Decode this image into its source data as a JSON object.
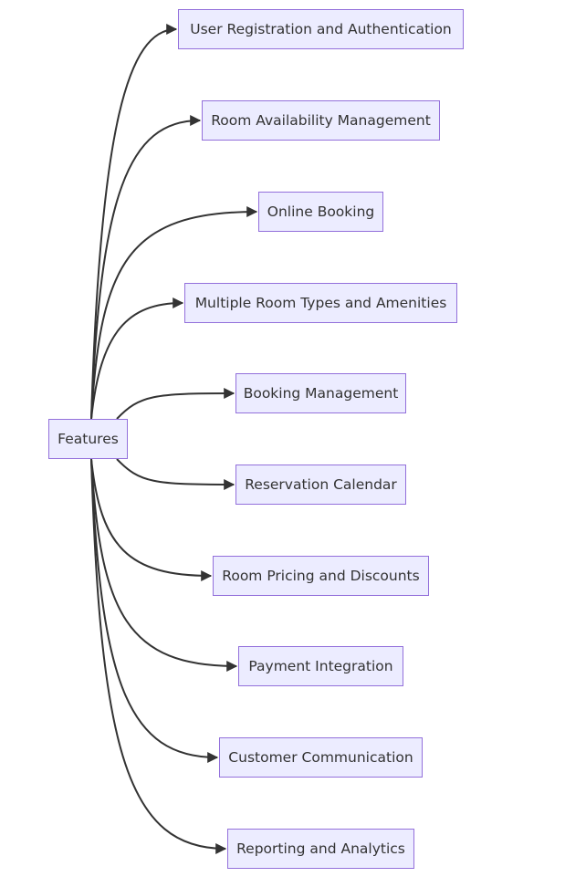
{
  "diagram": {
    "type": "flowchart",
    "direction": "left-to-right",
    "colors": {
      "node_fill": "#ECECFF",
      "node_stroke": "#9370DB",
      "edge": "#333333",
      "text": "#333333"
    },
    "root": {
      "id": "features",
      "label": "Features"
    },
    "children": [
      {
        "id": "user-registration",
        "label": "User Registration and Authentication"
      },
      {
        "id": "room-availability",
        "label": "Room Availability Management"
      },
      {
        "id": "online-booking",
        "label": "Online Booking"
      },
      {
        "id": "multiple-room-types",
        "label": "Multiple Room Types and Amenities"
      },
      {
        "id": "booking-management",
        "label": "Booking Management"
      },
      {
        "id": "reservation-calendar",
        "label": "Reservation Calendar"
      },
      {
        "id": "room-pricing",
        "label": "Room Pricing and Discounts"
      },
      {
        "id": "payment-integration",
        "label": "Payment Integration"
      },
      {
        "id": "customer-communication",
        "label": "Customer Communication"
      },
      {
        "id": "reporting-analytics",
        "label": "Reporting and Analytics"
      }
    ]
  }
}
